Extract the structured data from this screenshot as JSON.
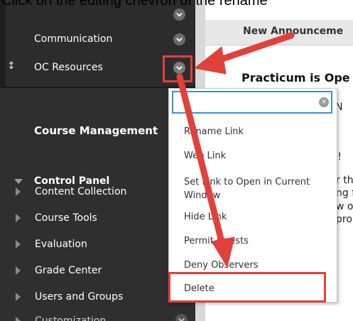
{
  "caption": "Click on the editing chevron of the rename",
  "sidebar": {
    "items": [
      {
        "label": "Communication"
      },
      {
        "label": "OC Resources"
      }
    ],
    "course_management_title": "Course Management",
    "control_panel": {
      "label": "Control Panel",
      "items": [
        {
          "label": "Content Collection"
        },
        {
          "label": "Course Tools"
        },
        {
          "label": "Evaluation"
        },
        {
          "label": "Grade Center"
        },
        {
          "label": "Users and Groups"
        },
        {
          "label": "Customization"
        }
      ]
    },
    "drag_glyph": "↕"
  },
  "main": {
    "tab_label": "New Announceme",
    "announcement_title": "Practicum is Ope",
    "fragments": [
      "y, N",
      "all!",
      "r tha",
      "ng f",
      "w o",
      "pro"
    ]
  },
  "context_menu": {
    "search": {
      "value": "",
      "placeholder": ""
    },
    "clear_glyph": "×",
    "items": [
      {
        "label": "Rename Link"
      },
      {
        "label": "Web Link"
      },
      {
        "label": "Set Link to Open in Current Window"
      },
      {
        "label": "Hide Link"
      },
      {
        "label": "Permit Guests"
      },
      {
        "label": "Deny Observers"
      },
      {
        "label": "Delete"
      }
    ]
  },
  "colors": {
    "sidebar_bg": "#2f2f2f",
    "annotation_red": "#e0413a",
    "input_focus": "#3a8fd6"
  },
  "icons": [
    "chevron-down-icon",
    "triangle-down-icon",
    "triangle-right-icon",
    "drag-handle-icon",
    "clear-icon",
    "arrow-annotation"
  ]
}
